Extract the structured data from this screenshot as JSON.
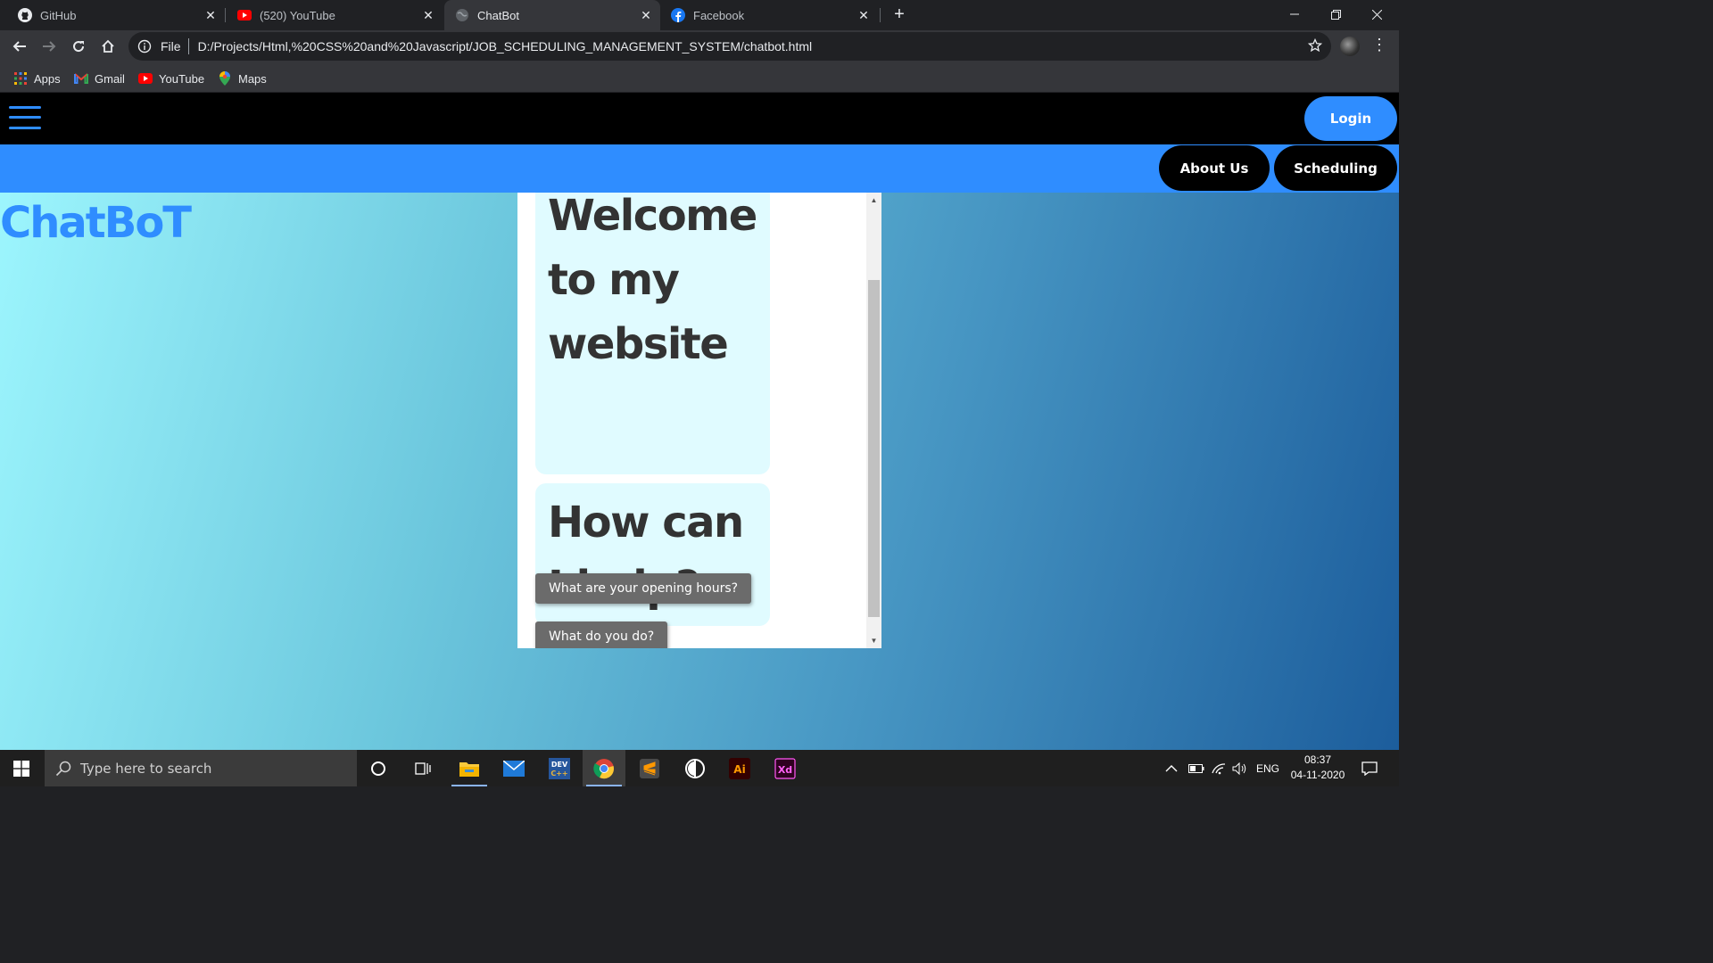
{
  "browser": {
    "tabs": [
      {
        "title": "GitHub",
        "icon": "github-icon"
      },
      {
        "title": "(520) YouTube",
        "icon": "youtube-icon"
      },
      {
        "title": "ChatBot",
        "icon": "globe-icon",
        "active": true
      },
      {
        "title": "Facebook",
        "icon": "facebook-icon"
      }
    ],
    "address": {
      "scheme": "File",
      "url": "D:/Projects/Html,%20CSS%20and%20Javascript/JOB_SCHEDULING_MANAGEMENT_SYSTEM/chatbot.html"
    },
    "bookmarks": [
      {
        "label": "Apps",
        "icon": "apps-grid-icon"
      },
      {
        "label": "Gmail",
        "icon": "gmail-icon"
      },
      {
        "label": "YouTube",
        "icon": "youtube-icon"
      },
      {
        "label": "Maps",
        "icon": "maps-pin-icon"
      }
    ]
  },
  "page": {
    "login_label": "Login",
    "nav": [
      {
        "label": "About Us"
      },
      {
        "label": "Scheduling"
      }
    ],
    "brand": "ChatBoT",
    "chat": {
      "messages": [
        {
          "text": "Welcome to my website"
        },
        {
          "text": "How can I help?"
        }
      ],
      "options": [
        {
          "label": "What are your opening hours?"
        },
        {
          "label": "What do you do?"
        }
      ]
    }
  },
  "taskbar": {
    "search_placeholder": "Type here to search",
    "language": "ENG",
    "time": "08:37",
    "date": "04-11-2020"
  },
  "colors": {
    "accent_blue": "#2f8dff",
    "nav_black": "#000000",
    "bubble_bg": "#e0fbff",
    "option_button": "#6b6b6b"
  }
}
